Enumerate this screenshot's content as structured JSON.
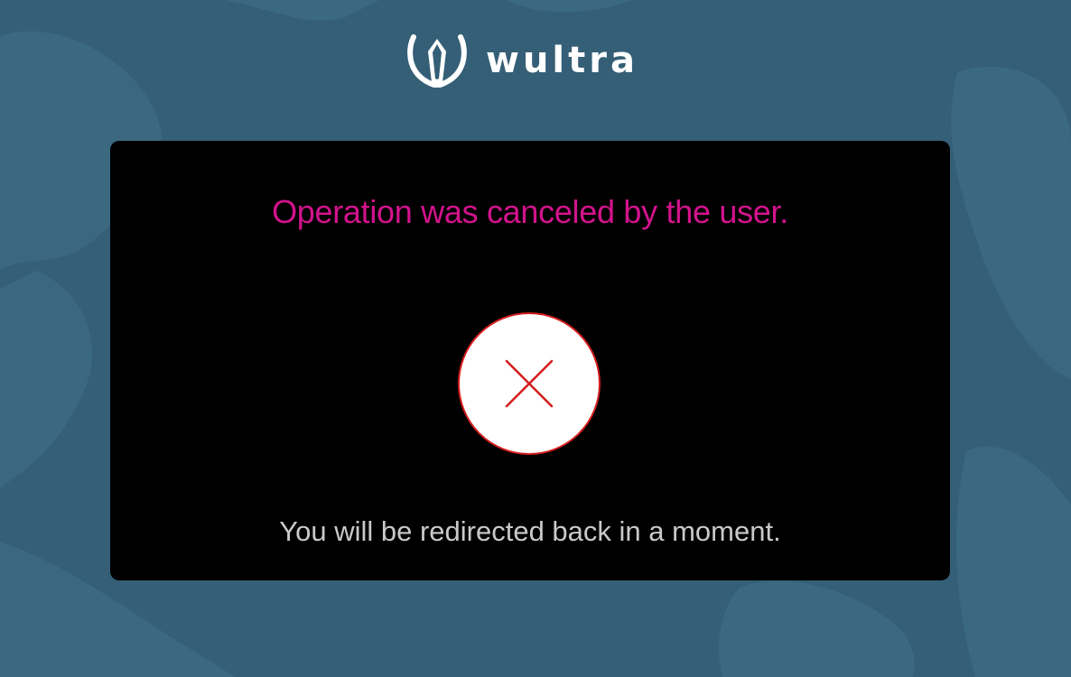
{
  "brand": {
    "name": "wultra",
    "logo_icon": "shield-logo-icon"
  },
  "message": {
    "title": "Operation was canceled by the user.",
    "status_icon": "close-x-icon",
    "subtitle": "You will be redirected back in a moment."
  },
  "colors": {
    "background": "#355f76",
    "card": "#000000",
    "title": "#d3138c",
    "error": "#d31e1e",
    "subtitle": "#c9c9c9"
  }
}
